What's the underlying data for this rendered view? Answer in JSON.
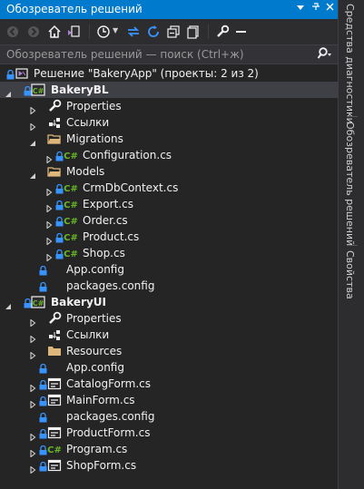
{
  "panel": {
    "title": "Обозреватель решений"
  },
  "search": {
    "placeholder": "Обозреватель решений — поиск (Ctrl+ж)"
  },
  "tree": [
    {
      "label": "Решение \"BakeryApp\" (проекты: 2 из 2)",
      "icon": "solution-icon",
      "bold": false
    },
    {
      "label": "BakeryBL",
      "icon": "csharp-project-icon",
      "bold": true
    },
    {
      "label": "Properties",
      "icon": "wrench-icon"
    },
    {
      "label": "Ссылки",
      "icon": "references-icon"
    },
    {
      "label": "Migrations",
      "icon": "folder-open-icon"
    },
    {
      "label": "Configuration.cs",
      "icon": "csharp-file-icon"
    },
    {
      "label": "Models",
      "icon": "folder-open-icon"
    },
    {
      "label": "CrmDbContext.cs",
      "icon": "csharp-file-icon"
    },
    {
      "label": "Export.cs",
      "icon": "csharp-file-icon"
    },
    {
      "label": "Order.cs",
      "icon": "csharp-file-icon"
    },
    {
      "label": "Product.cs",
      "icon": "csharp-file-icon"
    },
    {
      "label": "Shop.cs",
      "icon": "csharp-file-icon"
    },
    {
      "label": "App.config",
      "icon": "config-file-icon"
    },
    {
      "label": "packages.config",
      "icon": "config-file-icon"
    },
    {
      "label": "BakeryUI",
      "icon": "csharp-project-icon",
      "bold": true
    },
    {
      "label": "Properties",
      "icon": "wrench-icon"
    },
    {
      "label": "Ссылки",
      "icon": "references-icon"
    },
    {
      "label": "Resources",
      "icon": "folder-icon"
    },
    {
      "label": "App.config",
      "icon": "config-file-icon"
    },
    {
      "label": "CatalogForm.cs",
      "icon": "form-file-icon"
    },
    {
      "label": "MainForm.cs",
      "icon": "form-file-icon"
    },
    {
      "label": "packages.config",
      "icon": "config-file-icon"
    },
    {
      "label": "ProductForm.cs",
      "icon": "form-file-icon"
    },
    {
      "label": "Program.cs",
      "icon": "csharp-file-icon"
    },
    {
      "label": "ShopForm.cs",
      "icon": "form-file-icon"
    }
  ],
  "side_tabs": [
    {
      "label": "Средства диагностики"
    },
    {
      "label": "Обозреватель решений"
    },
    {
      "label": "Свойства"
    }
  ],
  "colors": {
    "accent": "#007acc",
    "background": "#252526",
    "csharp": "#68b723",
    "folder": "#dcb67a",
    "selection": "#3f3f46"
  }
}
